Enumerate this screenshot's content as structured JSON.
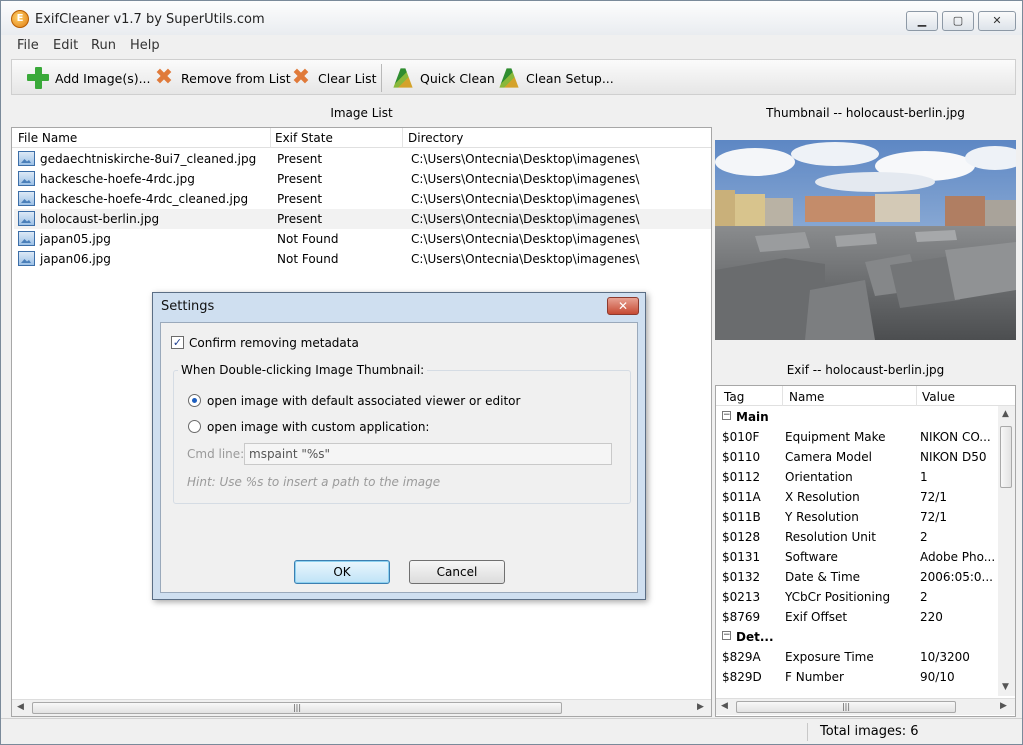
{
  "window": {
    "title": "ExifCleaner v1.7 by SuperUtils.com"
  },
  "menu": [
    "File",
    "Edit",
    "Run",
    "Help"
  ],
  "toolbar": {
    "add_images": "Add Image(s)...",
    "remove_from_list": "Remove from List",
    "clear_list": "Clear List",
    "quick_clean": "Quick Clean",
    "clean_setup": "Clean Setup..."
  },
  "image_list": {
    "title": "Image List",
    "columns": [
      "File Name",
      "Exif State",
      "Directory"
    ],
    "rows": [
      {
        "file": "gedaechtniskirche-8ui7_cleaned.jpg",
        "state": "Present",
        "dir": "C:\\Users\\Ontecnia\\Desktop\\imagenes\\"
      },
      {
        "file": "hackesche-hoefe-4rdc.jpg",
        "state": "Present",
        "dir": "C:\\Users\\Ontecnia\\Desktop\\imagenes\\"
      },
      {
        "file": "hackesche-hoefe-4rdc_cleaned.jpg",
        "state": "Present",
        "dir": "C:\\Users\\Ontecnia\\Desktop\\imagenes\\"
      },
      {
        "file": "holocaust-berlin.jpg",
        "state": "Present",
        "dir": "C:\\Users\\Ontecnia\\Desktop\\imagenes\\"
      },
      {
        "file": "japan05.jpg",
        "state": "Not Found",
        "dir": "C:\\Users\\Ontecnia\\Desktop\\imagenes\\"
      },
      {
        "file": "japan06.jpg",
        "state": "Not Found",
        "dir": "C:\\Users\\Ontecnia\\Desktop\\imagenes\\"
      }
    ],
    "selected_index": 3
  },
  "thumbnail": {
    "title": "Thumbnail -- holocaust-berlin.jpg"
  },
  "exif": {
    "title": "Exif -- holocaust-berlin.jpg",
    "columns": [
      "Tag",
      "Name",
      "Value"
    ],
    "rows": [
      {
        "group": true,
        "label": "Main"
      },
      {
        "tag": "$010F",
        "name": "Equipment Make",
        "value": "NIKON CO..."
      },
      {
        "tag": "$0110",
        "name": "Camera Model",
        "value": "NIKON D50"
      },
      {
        "tag": "$0112",
        "name": "Orientation",
        "value": "1"
      },
      {
        "tag": "$011A",
        "name": "X Resolution",
        "value": "72/1"
      },
      {
        "tag": "$011B",
        "name": "Y Resolution",
        "value": "72/1"
      },
      {
        "tag": "$0128",
        "name": "Resolution Unit",
        "value": "2"
      },
      {
        "tag": "$0131",
        "name": "Software",
        "value": "Adobe Pho..."
      },
      {
        "tag": "$0132",
        "name": "Date & Time",
        "value": "2006:05:0..."
      },
      {
        "tag": "$0213",
        "name": "YCbCr Positioning",
        "value": "2"
      },
      {
        "tag": "$8769",
        "name": "Exif Offset",
        "value": "220"
      },
      {
        "group": true,
        "label": "Det..."
      },
      {
        "tag": "$829A",
        "name": "Exposure Time",
        "value": "10/3200"
      },
      {
        "tag": "$829D",
        "name": "F Number",
        "value": "90/10"
      }
    ]
  },
  "status": {
    "text": "Total images: 6"
  },
  "dialog": {
    "title": "Settings",
    "confirm_label": "Confirm removing metadata",
    "confirm_checked": true,
    "group_label": "When Double-clicking Image Thumbnail:",
    "radio_default": "open image with default associated viewer or editor",
    "radio_custom": "open image with custom application:",
    "selected_option": "default",
    "cmd_label": "Cmd line:",
    "cmd_value": "mspaint \"%s\"",
    "hint": "Hint: Use %s to insert a path to the image",
    "ok": "OK",
    "cancel": "Cancel"
  },
  "icons": {
    "check": "✓",
    "scroll_left": "◀",
    "scroll_right": "▶",
    "scroll_up": "▲",
    "scroll_down": "▼",
    "grip": "|||",
    "collapse": "−",
    "close": "✕"
  }
}
